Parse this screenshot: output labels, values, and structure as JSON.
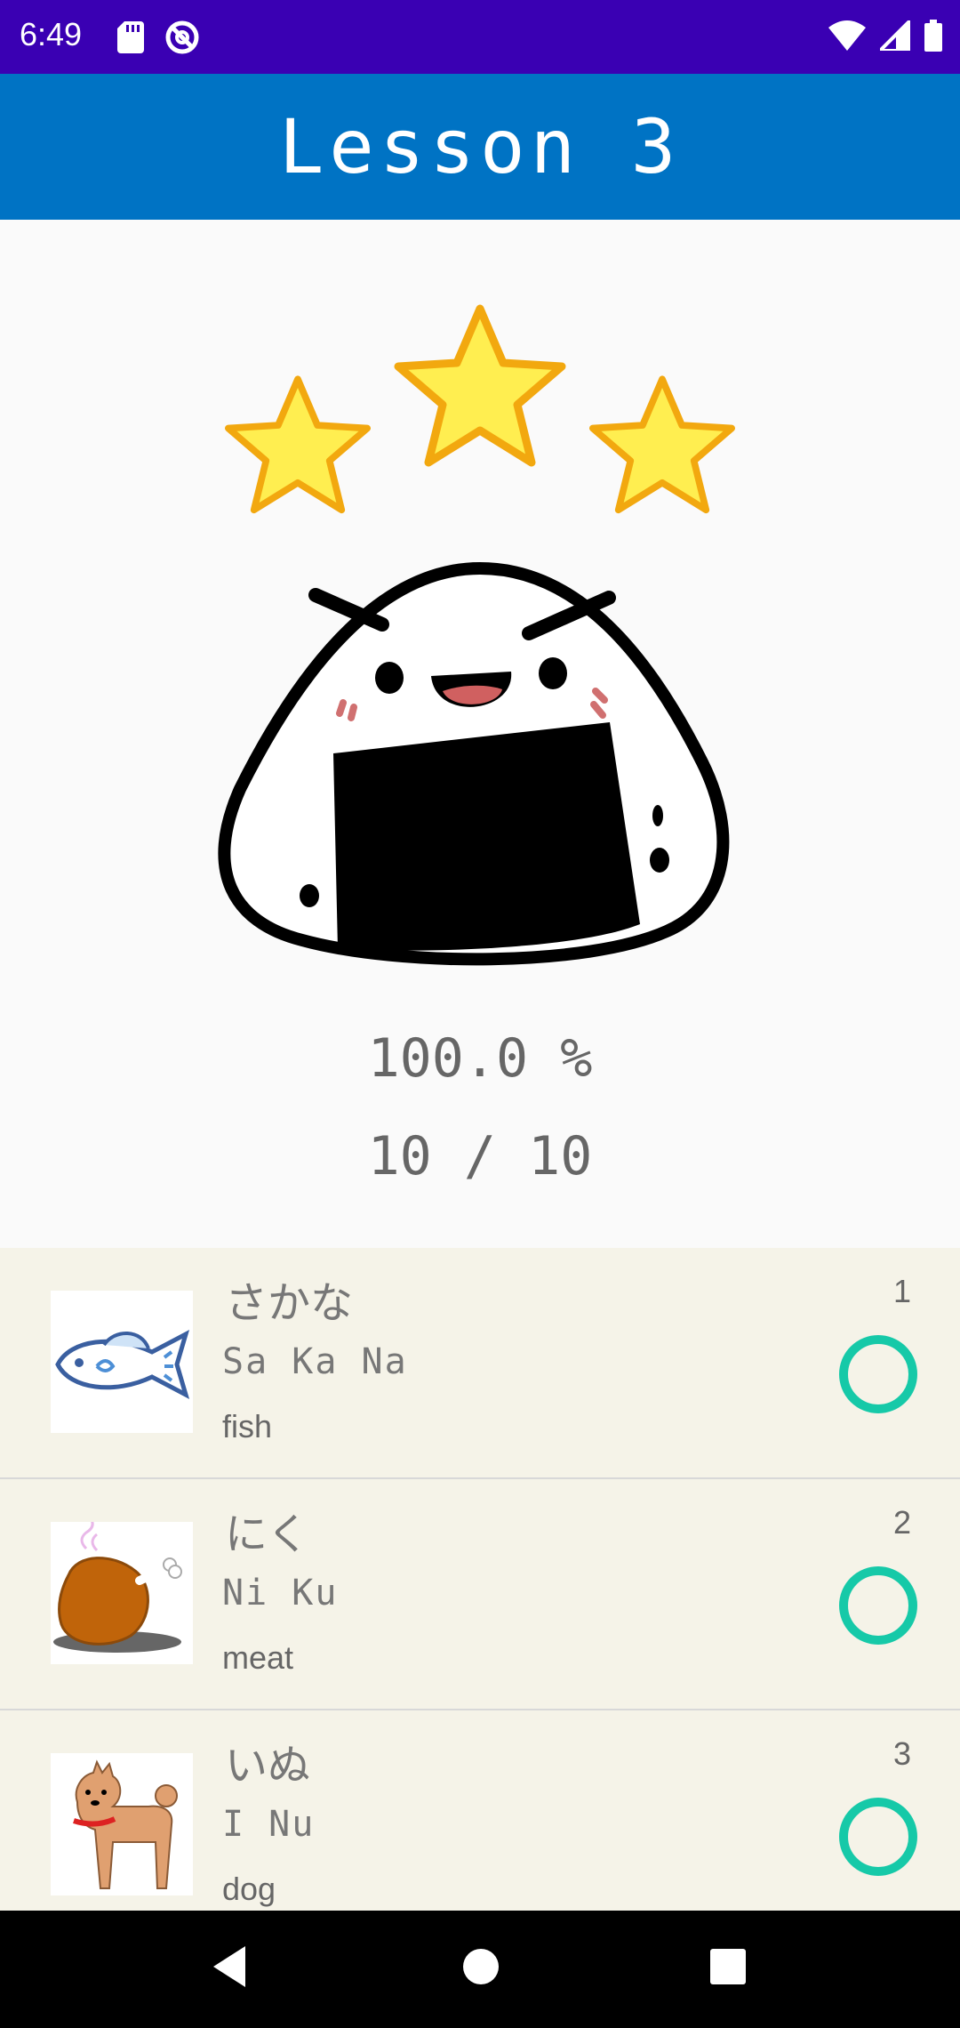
{
  "status_bar": {
    "time": "6:49",
    "icons": [
      "sd-card-icon",
      "do-not-disturb-icon",
      "wifi-icon",
      "cell-signal-icon",
      "battery-icon"
    ]
  },
  "app_bar": {
    "title": "Lesson 3"
  },
  "result": {
    "stars_earned": 3,
    "stars_total": 3,
    "percentage": "100.0 %",
    "score": "10 / 10"
  },
  "words": [
    {
      "kana": "さかな",
      "romaji": "Sa Ka Na",
      "english": "fish",
      "number": "1",
      "result": "correct",
      "image": "fish-image"
    },
    {
      "kana": "にく",
      "romaji": "Ni Ku",
      "english": "meat",
      "number": "2",
      "result": "correct",
      "image": "meat-image"
    },
    {
      "kana": "いぬ",
      "romaji": "I Nu",
      "english": "dog",
      "number": "3",
      "result": "correct",
      "image": "dog-image"
    }
  ],
  "nav_bar": {
    "buttons": [
      "back-icon",
      "home-icon",
      "recents-icon"
    ]
  },
  "colors": {
    "status_bar": "#3a00b3",
    "app_bar": "#0073c4",
    "list_background": "#f5f3e8",
    "correct_mark": "#16c9a8",
    "star_fill": "#ffee50",
    "star_stroke": "#f2a80f"
  }
}
